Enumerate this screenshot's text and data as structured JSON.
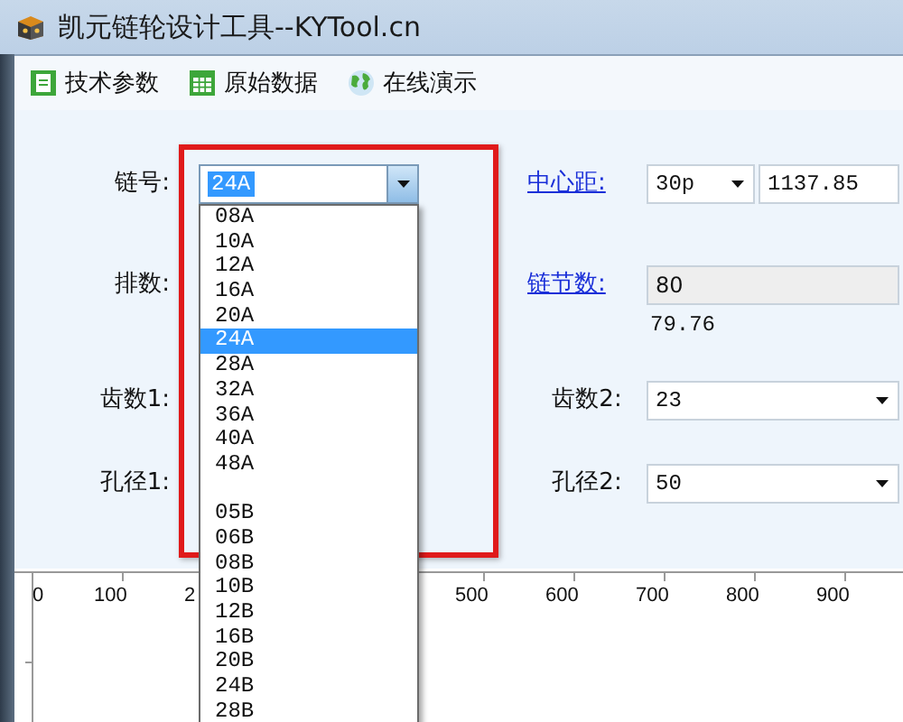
{
  "window": {
    "title": "凯元链轮设计工具--KYTool.cn"
  },
  "toolbar": [
    {
      "label": "技术参数",
      "kind": "document"
    },
    {
      "label": "原始数据",
      "kind": "table"
    },
    {
      "label": "在线演示",
      "kind": "globe"
    }
  ],
  "form": {
    "left": [
      {
        "label": "链号:",
        "combo": {
          "value": "24A",
          "expanded": true
        }
      },
      {
        "label": "排数:"
      },
      {
        "label": "齿数1:"
      },
      {
        "label": "孔径1:"
      }
    ],
    "right": [
      {
        "label": "中心距:",
        "kind": "link-combo-input",
        "combo": "30p",
        "value": "1137.85"
      },
      {
        "label": "链节数:",
        "kind": "link-readonly",
        "value": "80",
        "note": "79.76"
      },
      {
        "label": "齿数2:",
        "kind": "combo",
        "value": "23"
      },
      {
        "label": "孔径2:",
        "kind": "combo",
        "value": "50"
      }
    ]
  },
  "highlight_frame": true,
  "dropdown": [
    {
      "kind": "item",
      "text": "08A",
      "selected": false
    },
    {
      "kind": "item",
      "text": "10A",
      "selected": false
    },
    {
      "kind": "item",
      "text": "12A",
      "selected": false
    },
    {
      "kind": "item",
      "text": "16A",
      "selected": false
    },
    {
      "kind": "item",
      "text": "20A",
      "selected": false
    },
    {
      "kind": "item",
      "text": "24A",
      "selected": true
    },
    {
      "kind": "item",
      "text": "28A",
      "selected": false
    },
    {
      "kind": "item",
      "text": "32A",
      "selected": false
    },
    {
      "kind": "item",
      "text": "36A",
      "selected": false
    },
    {
      "kind": "item",
      "text": "40A",
      "selected": false
    },
    {
      "kind": "item",
      "text": "48A",
      "selected": false
    },
    {
      "kind": "gap"
    },
    {
      "kind": "item",
      "text": "05B",
      "selected": false
    },
    {
      "kind": "item",
      "text": "06B",
      "selected": false
    },
    {
      "kind": "item",
      "text": "08B",
      "selected": false
    },
    {
      "kind": "item",
      "text": "10B",
      "selected": false
    },
    {
      "kind": "item",
      "text": "12B",
      "selected": false
    },
    {
      "kind": "item",
      "text": "16B",
      "selected": false
    },
    {
      "kind": "item",
      "text": "20B",
      "selected": false
    },
    {
      "kind": "item",
      "text": "24B",
      "selected": false
    },
    {
      "kind": "item",
      "text": "28B",
      "selected": false
    }
  ],
  "ruler": {
    "ticks": [
      {
        "kind": "labeled",
        "label": "0"
      },
      {
        "kind": "labeled",
        "label": "100"
      },
      {
        "kind": "labeled",
        "label": "2"
      },
      {
        "kind": "covered"
      },
      {
        "kind": "covered"
      },
      {
        "kind": "labeled",
        "label": "500"
      },
      {
        "kind": "labeled",
        "label": "600"
      },
      {
        "kind": "labeled",
        "label": "700"
      },
      {
        "kind": "labeled",
        "label": "800"
      },
      {
        "kind": "labeled",
        "label": "900"
      }
    ]
  }
}
